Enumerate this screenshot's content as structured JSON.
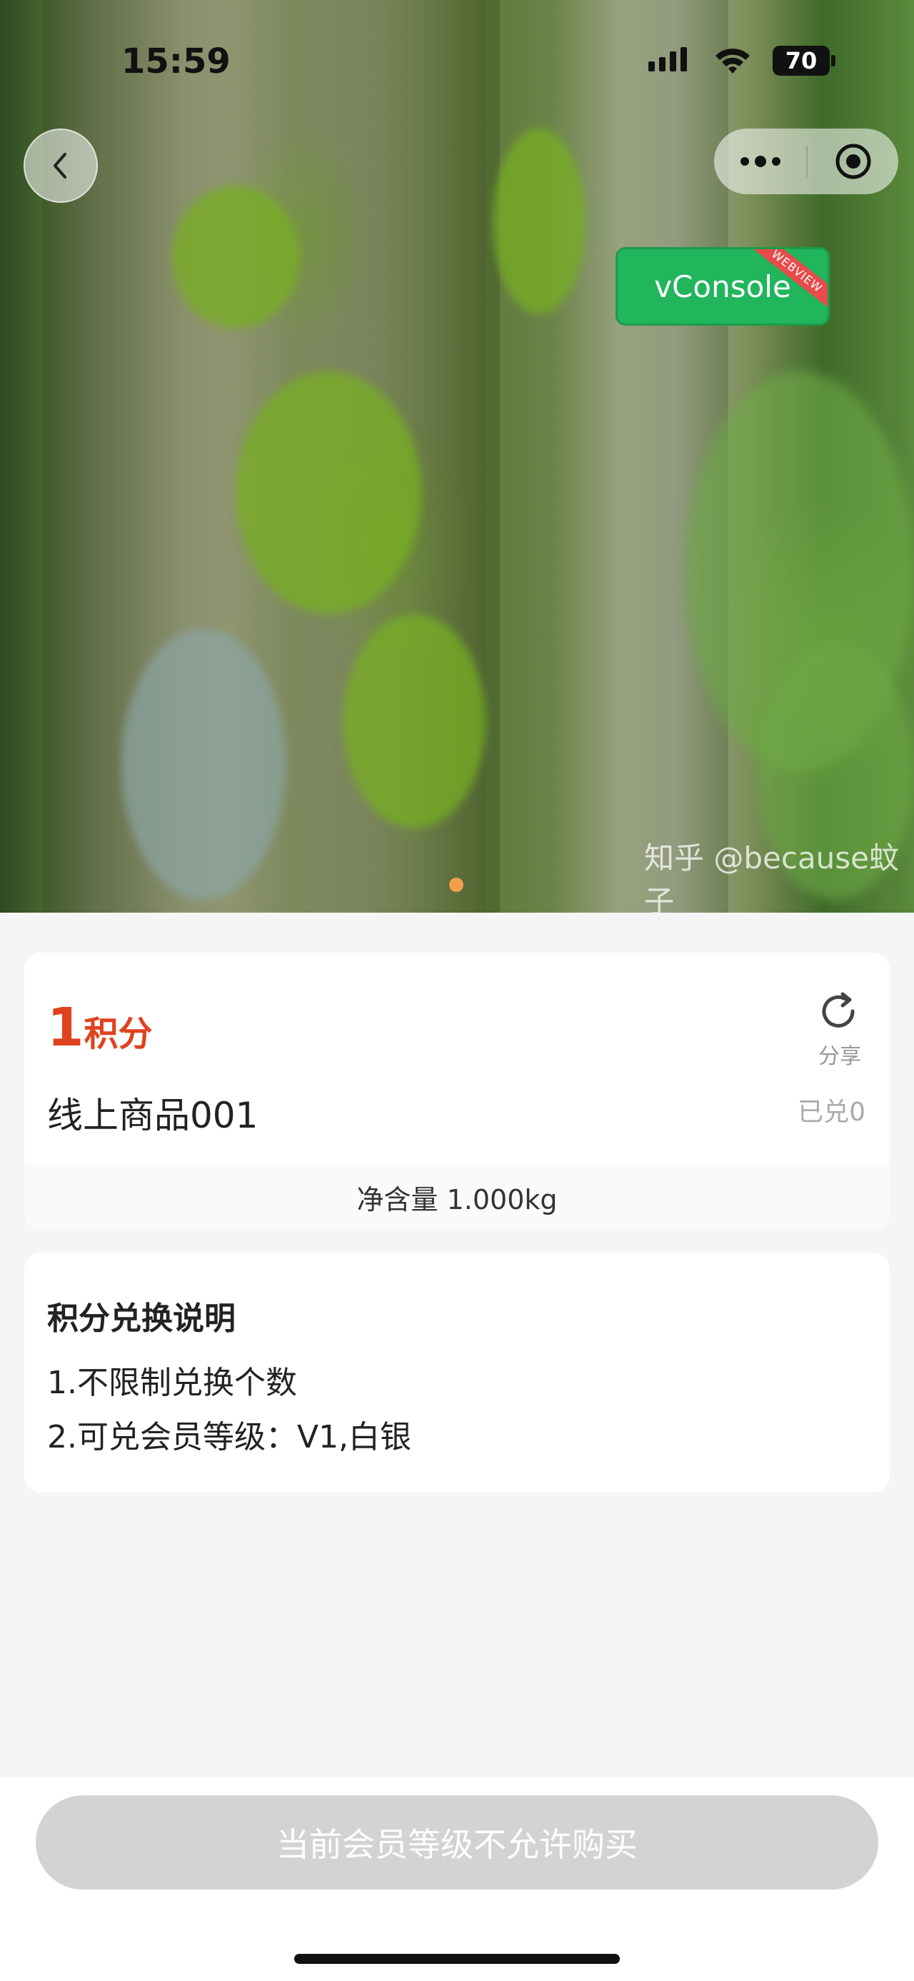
{
  "status_bar": {
    "time": "15:59",
    "battery": "70"
  },
  "nav": {
    "back_icon": "chevron-left-icon",
    "more_icon": "more-dots-icon",
    "close_icon": "record-target-icon"
  },
  "vconsole": {
    "label": "vConsole",
    "badge": "WEBVIEW"
  },
  "hero": {
    "watermark": "知乎 @because蚊子",
    "carousel_index": 1,
    "carousel_total": 1
  },
  "product": {
    "price_number": "1",
    "price_unit": "积分",
    "share_label": "分享",
    "title": "线上商品001",
    "sold": "已兑0",
    "spec": "净含量 1.000kg"
  },
  "exchange": {
    "title": "积分兑换说明",
    "lines": [
      "1.不限制兑换个数",
      "2.可兑会员等级：V1,白银"
    ]
  },
  "action": {
    "buy_label": "当前会员等级不允许购买"
  },
  "colors": {
    "accent": "#e0421f",
    "vconsole": "#21b55c",
    "disabled": "#d3d3d3"
  }
}
